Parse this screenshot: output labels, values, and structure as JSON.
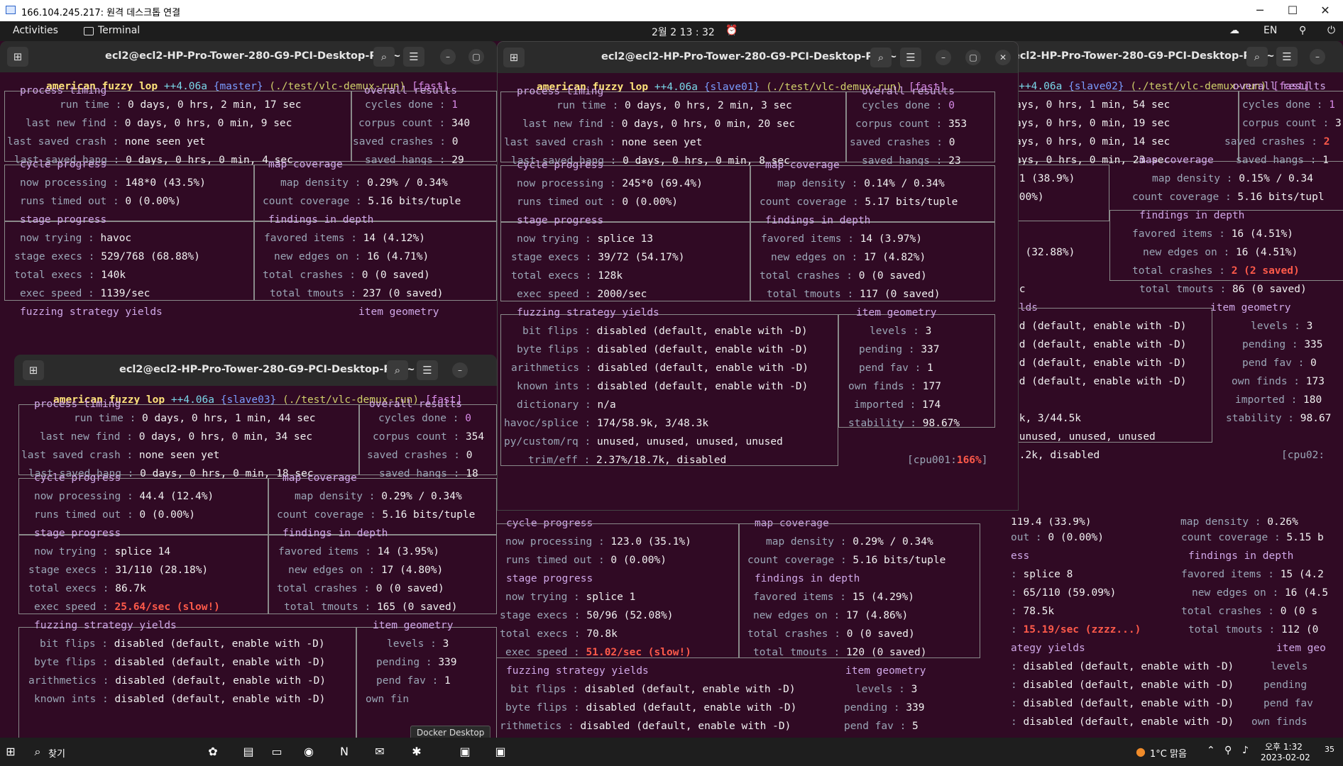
{
  "rdp": {
    "title": "166.104.245.217: 원격 데스크톱 연결",
    "min": "─",
    "max": "☐",
    "close": "✕"
  },
  "topbar": {
    "activities": "Activities",
    "app": "Terminal",
    "clock": "2월 2  13 : 32",
    "lang": "EN"
  },
  "windows": [
    {
      "id": "master",
      "title": "ecl2@ecl2-HP-Pro-Tower-280-G9-PCI-Desktop-PC: ~",
      "banner": {
        "prefix": "american fuzzy lop ",
        "ver": "++4.06a",
        "name": "{master}",
        "path": "(./test/vlc-demux-run)",
        "mode": "[fast]"
      },
      "run_time": "0 days, 0 hrs, 2 min, 17 sec",
      "last_new_find": "0 days, 0 hrs, 0 min, 9 sec",
      "last_saved_crash": "none seen yet",
      "last_saved_hang": "0 days, 0 hrs, 0 min, 4 sec",
      "cycles_done": "1",
      "corpus_count": "340",
      "saved_crashes": "0",
      "saved_hangs": "29",
      "now_processing": "148*0 (43.5%)",
      "runs_timed_out": "0 (0.00%)",
      "map_density": "0.29% / 0.34%",
      "count_coverage": "5.16 bits/tuple",
      "now_trying": "havoc",
      "stage_execs": "529/768 (68.88%)",
      "total_execs": "140k",
      "exec_speed": "1139/sec",
      "favored_items": "14 (4.12%)",
      "new_edges_on": "16 (4.71%)",
      "total_crashes": "0 (0 saved)",
      "total_tmouts": "237 (0 saved)"
    },
    {
      "id": "slave01",
      "title": "ecl2@ecl2-HP-Pro-Tower-280-G9-PCI-Desktop-PC: ~",
      "banner": {
        "prefix": "american fuzzy lop ",
        "ver": "++4.06a",
        "name": "{slave01}",
        "path": "(./test/vlc-demux-run)",
        "mode": "[fast]"
      },
      "run_time": "0 days, 0 hrs, 2 min, 3 sec",
      "last_new_find": "0 days, 0 hrs, 0 min, 20 sec",
      "last_saved_crash": "none seen yet",
      "last_saved_hang": "0 days, 0 hrs, 0 min, 8 sec",
      "cycles_done": "0",
      "corpus_count": "353",
      "saved_crashes": "0",
      "saved_hangs": "23",
      "now_processing": "245*0 (69.4%)",
      "runs_timed_out": "0 (0.00%)",
      "map_density": "0.14% / 0.34%",
      "count_coverage": "5.17 bits/tuple",
      "now_trying": "splice 13",
      "stage_execs": "39/72 (54.17%)",
      "total_execs": "128k",
      "exec_speed": "2000/sec",
      "favored_items": "14 (3.97%)",
      "new_edges_on": "17 (4.82%)",
      "total_crashes": "0 (0 saved)",
      "total_tmouts": "117 (0 saved)",
      "bit_flips": "disabled (default, enable with -D)",
      "byte_flips": "disabled (default, enable with -D)",
      "arithmetics": "disabled (default, enable with -D)",
      "known_ints": "disabled (default, enable with -D)",
      "dictionary": "n/a",
      "havoc_splice": "174/58.9k, 3/48.3k",
      "py_custom_rq": "unused, unused, unused, unused",
      "trim_eff": "2.37%/18.7k, disabled",
      "levels": "3",
      "pending": "337",
      "pend_fav": "1",
      "own_finds": "177",
      "imported": "174",
      "stability": "98.67%",
      "cpu": "[cpu001:",
      "cpu_pct": "166%",
      "cpu_end": "]"
    },
    {
      "id": "slave02",
      "title": "ecl2-HP-Pro-Tower-280-G9-PCI-Desktop-PC: ~",
      "banner": {
        "prefix": "op ",
        "ver": "++4.06a",
        "name": "{slave02}",
        "path": "(./test/vlc-demux-run)",
        "mode": "[fast]"
      },
      "run_time": "ays, 0 hrs, 1 min, 54 sec",
      "last_new_find": "ays, 0 hrs, 0 min, 19 sec",
      "last_saved_crash": "ays, 0 hrs, 0 min, 14 sec",
      "last_saved_hang": "ays, 0 hrs, 0 min, 23 sec",
      "cycles_done": "1",
      "corpus_count": "3",
      "saved_crashes": "2",
      "saved_hangs": "1",
      "now_processing": ".1 (38.9%)",
      "runs_timed_out": ".00%)",
      "map_density": "0.15% / 0.34",
      "count_coverage": "5.16 bits/tupl",
      "stage_execs": ") (32.88%)",
      "exec_speed": "ec",
      "favored_items": "16 (4.51%)",
      "new_edges_on": "16 (4.51%)",
      "total_crashes": "2 (2 saved)",
      "total_tmouts": "86 (0 saved)",
      "yields_head": "elds",
      "bit_flips": "ed (default, enable with -D)",
      "byte_flips": "ed (default, enable with -D)",
      "arithmetics": "ed (default, enable with -D)",
      "known_ints": "ed (default, enable with -D)",
      "havoc_splice": "7k, 3/44.5k",
      "py_custom_rq": " unused, unused, unused",
      "trim_eff": "2.2k, disabled",
      "levels": "3",
      "pending": "335",
      "pend_fav": "0",
      "own_finds": "173",
      "imported": "180",
      "stability": "98.67",
      "cpu": "[cpu02:"
    },
    {
      "id": "slave03",
      "title": "ecl2@ecl2-HP-Pro-Tower-280-G9-PCI-Desktop-PC: ~",
      "banner": {
        "prefix": "american fuzzy lop ",
        "ver": "++4.06a",
        "name": "{slave03}",
        "path": "(./test/vlc-demux-run)",
        "mode": "[fast]"
      },
      "run_time": "0 days, 0 hrs, 1 min, 44 sec",
      "last_new_find": "0 days, 0 hrs, 0 min, 34 sec",
      "last_saved_crash": "none seen yet",
      "last_saved_hang": "0 days, 0 hrs, 0 min, 18 sec",
      "cycles_done": "0",
      "corpus_count": "354",
      "saved_crashes": "0",
      "saved_hangs": "18",
      "now_processing": "44.4 (12.4%)",
      "runs_timed_out": "0 (0.00%)",
      "map_density": "0.29% / 0.34%",
      "count_coverage": "5.16 bits/tuple",
      "now_trying": "splice 14",
      "stage_execs": "31/110 (28.18%)",
      "total_execs": "86.7k",
      "exec_speed": "25.64/sec (slow!)",
      "favored_items": "14 (3.95%)",
      "new_edges_on": "17 (4.80%)",
      "total_crashes": "0 (0 saved)",
      "total_tmouts": "165 (0 saved)",
      "bit_flips": "disabled (default, enable with -D)",
      "byte_flips": "disabled (default, enable with -D)",
      "arithmetics": "disabled (default, enable with -D)",
      "known_ints": "disabled (default, enable with -D)",
      "levels": "3",
      "pending": "339",
      "pend_fav": "1",
      "own_finds": "own fin"
    }
  ],
  "behind_middle": {
    "now_processing": "123.0 (35.1%)",
    "runs_timed_out": "0 (0.00%)",
    "map_density": "0.29% / 0.34%",
    "count_coverage": "5.16 bits/tuple",
    "now_trying": "splice 1",
    "stage_execs": "50/96 (52.08%)",
    "total_execs": "70.8k",
    "exec_speed": "51.02/sec (slow!)",
    "favored_items": "15 (4.29%)",
    "new_edges_on": "17 (4.86%)",
    "total_crashes": "0 (0 saved)",
    "total_tmouts": "120 (0 saved)",
    "bit_flips": "disabled (default, enable with -D)",
    "byte_flips": "disabled (default, enable with -D)",
    "arithmetics": "disabled (default, enable with -D)",
    "levels": "3",
    "pending": "339",
    "pend_fav": "5"
  },
  "behind_right": {
    "now_processing": "119.4 (33.9%)",
    "runs_timed_out": "0 (0.00%)",
    "map_density": "0.26%",
    "count_coverage": "5.15 b",
    "now_trying": "splice 8",
    "stage_execs": "65/110 (59.09%)",
    "total_execs": "78.5k",
    "exec_speed": "15.19/sec (zzzz...)",
    "favored_items": "15 (4.2",
    "new_edges_on": "16 (4.5",
    "total_crashes": "0 (0 s",
    "total_tmouts": "112 (0",
    "bit_flips": "disabled (default, enable with -D)",
    "byte_flips": "disabled (default, enable with -D)",
    "arithmetics": "disabled (default, enable with -D)",
    "known_ints": "disabled (default, enable with -D)"
  },
  "labels": {
    "process_timing": "process timing",
    "overall_results": "overall results",
    "cycle_progress": "cycle progress",
    "map_coverage": "map coverage",
    "stage_progress": "stage progress",
    "findings_in_depth": "findings in depth",
    "fuzzing_strategy_yields": "fuzzing strategy yields",
    "item_geometry": "item geometry"
  },
  "taskbar": {
    "search": "찾기",
    "weather": "1°C 맑음",
    "time": "오후 1:32",
    "date": "2023-02-02",
    "tooltip": "Docker Desktop",
    "notif": "35"
  }
}
